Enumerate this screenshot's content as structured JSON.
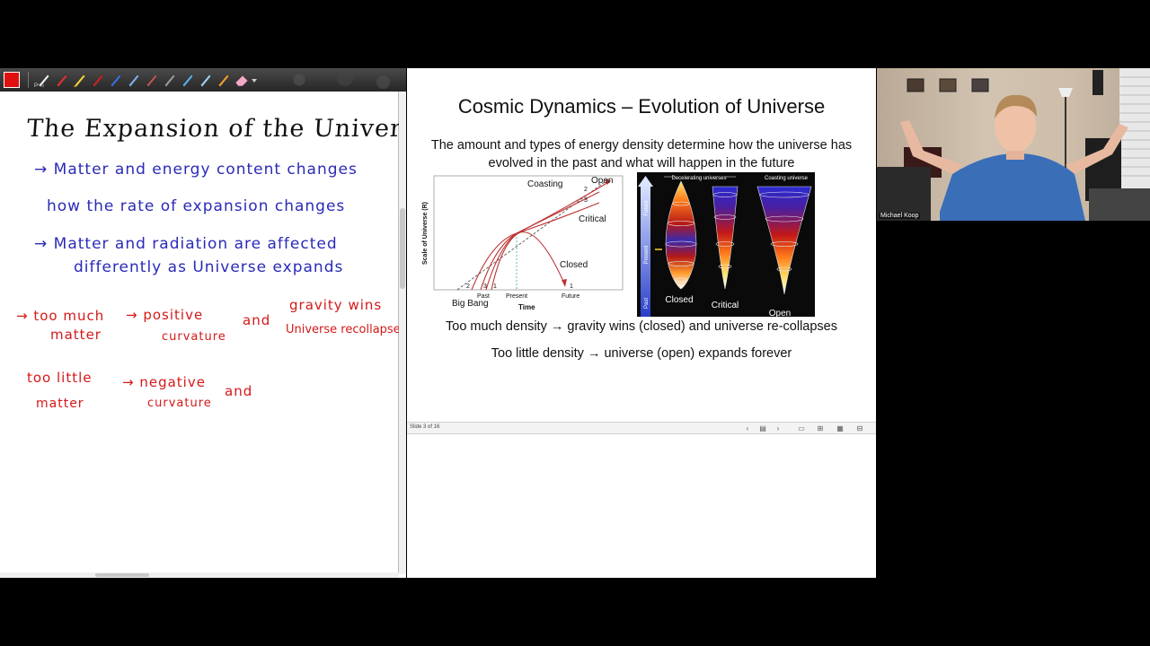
{
  "whiteboard": {
    "tool_label": "Pen",
    "colors": {
      "pen": "#e01010",
      "blue_ink": "#2a2ab8",
      "red_ink": "#d41818"
    },
    "toolbar_icons": [
      "pen-color-swatch",
      "pen-icon",
      "pen-icon",
      "highlighter-icon",
      "pen-icon",
      "pen-icon",
      "pen-icon",
      "pen-icon",
      "pen-icon",
      "pen-icon",
      "pen-icon",
      "pen-icon",
      "eraser-icon",
      "dropdown-arrow-icon"
    ],
    "title": "The Expansion of the Universe",
    "notes": [
      {
        "ink": "blue",
        "lines": [
          "→ Matter and energy content changes",
          "how the rate of expansion changes"
        ]
      },
      {
        "ink": "blue",
        "lines": [
          "→ Matter and radiation are affected",
          "differently as Universe expands"
        ]
      },
      {
        "ink": "red",
        "lines": [
          "→ too much",
          "matter",
          "→ positive",
          "curvature",
          "and",
          "gravity wins",
          "Universe recollapses"
        ]
      },
      {
        "ink": "red",
        "lines": [
          "too little",
          "matter",
          "→ negative",
          "curvature",
          "and"
        ]
      }
    ]
  },
  "slide": {
    "title": "Cosmic Dynamics – Evolution of Universe",
    "intro": "The amount and types of energy density determine how the universe has evolved in the past and what will happen in the future",
    "line1": "Too much density → gravity wins (closed) and universe re-collapses",
    "line2": "Too little density → universe (open) expands forever",
    "graph": {
      "ylabel": "Scale of Universe (R)",
      "xlabel": "Time",
      "curve_labels": {
        "coasting": "Coasting",
        "open": "Open",
        "critical": "Critical",
        "closed": "Closed"
      },
      "numbers": {
        "n1": "1",
        "n2": "2",
        "n3": "3"
      },
      "x_ticks": {
        "big_bang": "Big Bang",
        "past": "Past",
        "present": "Present",
        "future": "Future"
      }
    },
    "universes": {
      "decelerating": "Decelerating universes",
      "coasting": "Coasting universe",
      "axis_future": "Future",
      "axis_present": "Present",
      "axis_past": "Past",
      "closed": "Closed",
      "critical": "Critical",
      "open": "Open"
    },
    "status": {
      "counter": "Slide 3 of 16"
    }
  },
  "webcam": {
    "name": "Michael Koop"
  }
}
